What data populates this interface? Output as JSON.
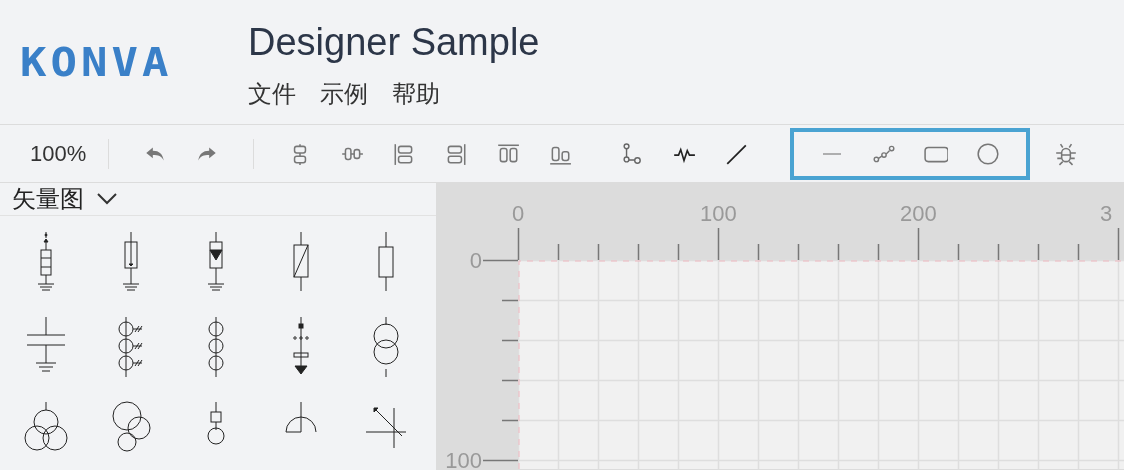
{
  "header": {
    "logo": "KONVA",
    "title": "Designer Sample",
    "menu": [
      "文件",
      "示例",
      "帮助"
    ]
  },
  "toolbar": {
    "zoom": "100%",
    "groups": [
      {
        "kind": "history",
        "highlighted": false,
        "items": [
          {
            "kind": "undo"
          },
          {
            "kind": "redo"
          }
        ]
      },
      {
        "kind": "align",
        "highlighted": false,
        "items": [
          {
            "kind": "align-center"
          },
          {
            "kind": "align-middle"
          },
          {
            "kind": "align-left"
          },
          {
            "kind": "align-right"
          },
          {
            "kind": "align-top"
          },
          {
            "kind": "align-bottom"
          }
        ]
      },
      {
        "kind": "connect",
        "highlighted": false,
        "items": [
          {
            "kind": "connector"
          },
          {
            "kind": "wave"
          },
          {
            "kind": "line"
          }
        ]
      },
      {
        "kind": "draw",
        "highlighted": true,
        "items": [
          {
            "kind": "straight"
          },
          {
            "kind": "polyline"
          },
          {
            "kind": "rect"
          },
          {
            "kind": "circle"
          }
        ]
      },
      {
        "kind": "debug",
        "highlighted": false,
        "items": [
          {
            "kind": "bug"
          }
        ]
      }
    ]
  },
  "sidebar": {
    "dropdown": "矢量图"
  },
  "canvas": {
    "ruler": {
      "x_labels": [
        "0",
        "100",
        "200",
        "3"
      ],
      "y_labels": [
        "0",
        "100"
      ]
    }
  }
}
